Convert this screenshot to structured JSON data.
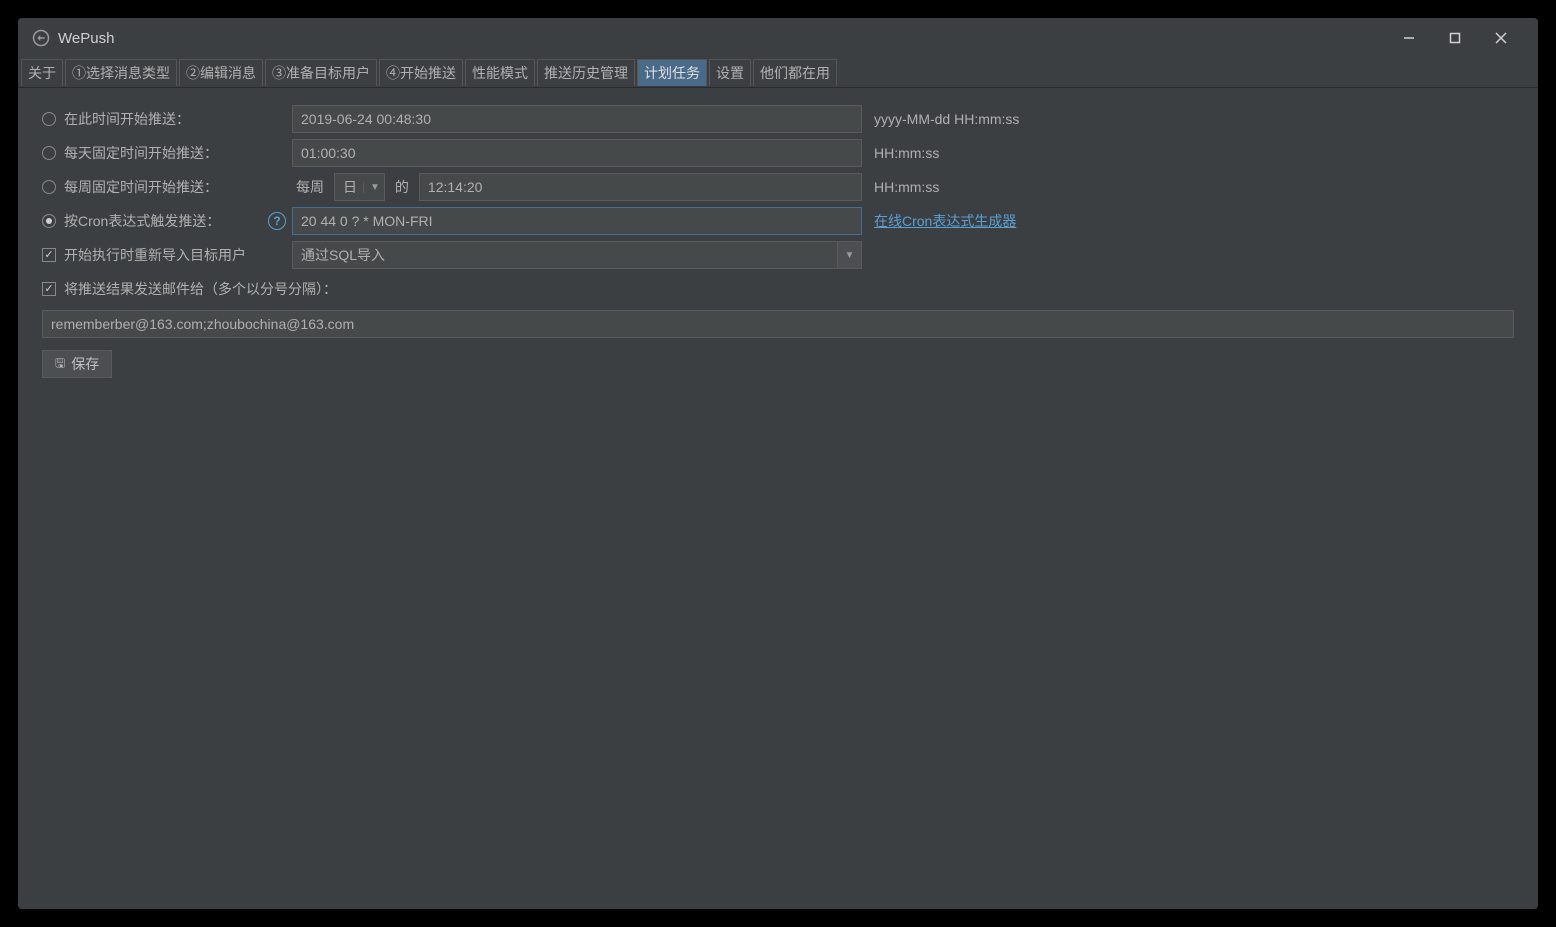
{
  "window": {
    "title": "WePush"
  },
  "tabs": [
    "关于",
    "①选择消息类型",
    "②编辑消息",
    "③准备目标用户",
    "④开始推送",
    "性能模式",
    "推送历史管理",
    "计划任务",
    "设置",
    "他们都在用"
  ],
  "activeTabIndex": 7,
  "form": {
    "startAt": {
      "label": "在此时间开始推送：",
      "value": "2019-06-24 00:48:30",
      "hint": "yyyy-MM-dd HH:mm:ss"
    },
    "daily": {
      "label": "每天固定时间开始推送：",
      "value": "01:00:30",
      "hint": "HH:mm:ss"
    },
    "weekly": {
      "label": "每周固定时间开始推送：",
      "prefix": "每周",
      "day": "日",
      "mid": "的",
      "time": "12:14:20",
      "hint": "HH:mm:ss"
    },
    "cron": {
      "label": "按Cron表达式触发推送：",
      "value": "20 44 0 ? * MON-FRI",
      "link": "在线Cron表达式生成器"
    },
    "reimport": {
      "label": "开始执行时重新导入目标用户",
      "value": "通过SQL导入"
    },
    "email": {
      "label": "将推送结果发送邮件给（多个以分号分隔）：",
      "value": "rememberber@163.com;zhoubochina@163.com"
    },
    "saveLabel": "保存"
  }
}
